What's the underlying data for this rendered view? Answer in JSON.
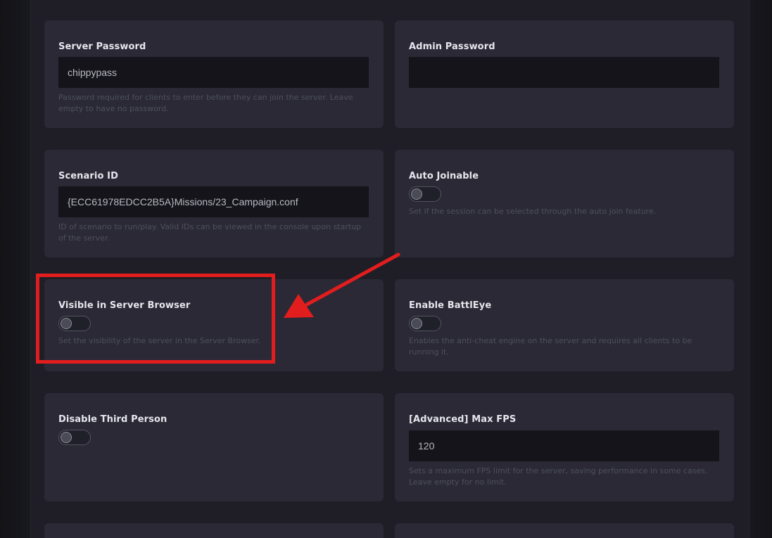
{
  "fields": {
    "server_password": {
      "label": "Server Password",
      "value": "chippypass",
      "help": "Password required for clients to enter before they can join the server. Leave empty to have no password."
    },
    "admin_password": {
      "label": "Admin Password",
      "value": ""
    },
    "scenario_id": {
      "label": "Scenario ID",
      "value": "{ECC61978EDCC2B5A}Missions/23_Campaign.conf",
      "help": "ID of scenario to run/play. Valid IDs can be viewed in the console upon startup of the server."
    },
    "auto_joinable": {
      "label": "Auto Joinable",
      "enabled": false,
      "help": "Set if the session can be selected through the auto join feature."
    },
    "visible_in_browser": {
      "label": "Visible in Server Browser",
      "enabled": false,
      "help": "Set the visibility of the server in the Server Browser."
    },
    "enable_battleye": {
      "label": "Enable BattlEye",
      "enabled": false,
      "help": "Enables the anti-cheat engine on the server and requires all clients to be running it."
    },
    "disable_third_person": {
      "label": "Disable Third Person",
      "enabled": false
    },
    "max_fps": {
      "label": "[Advanced] Max FPS",
      "value": "120",
      "help": "Sets a maximum FPS limit for the server, saving performance in some cases. Leave empty for no limit."
    }
  },
  "annotation": {
    "color": "#e21d1d"
  }
}
